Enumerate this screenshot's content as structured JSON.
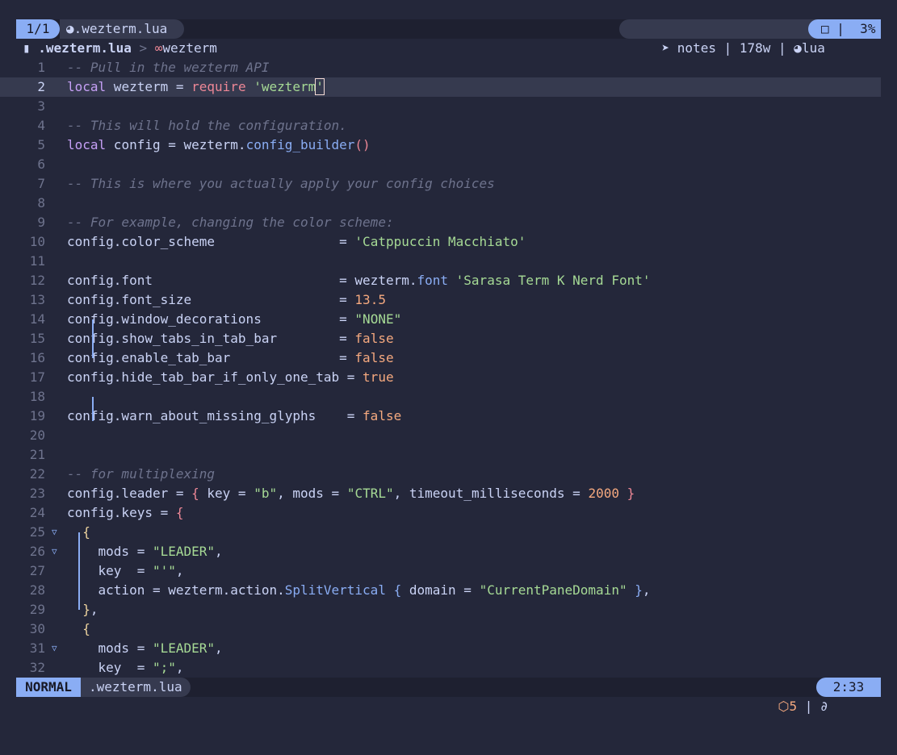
{
  "tabline": {
    "tab_count": "1/1",
    "file_icon": "lua-icon",
    "file_name": ".wezterm.lua",
    "right_icon": "notes-icon",
    "right_text": "notes | 178w | ",
    "lang_icon": "lua-icon",
    "lang": "lua",
    "window_icon": "square-icon",
    "percent": " 3%"
  },
  "winbar": {
    "file": ".wezterm.lua",
    "sep": " > ",
    "symbol_icon": "module-icon",
    "symbol": "wezterm"
  },
  "lines": [
    {
      "n": "1",
      "t": [
        {
          "c": "c",
          "v": "-- Pull in the wezterm API"
        }
      ]
    },
    {
      "n": "2",
      "cur": true,
      "t": [
        {
          "c": "k",
          "v": "local"
        },
        {
          "v": " wezterm = "
        },
        {
          "c": "f",
          "v": "require"
        },
        {
          "v": " "
        },
        {
          "c": "s",
          "v": "'wezterm"
        },
        {
          "c": "s cursor",
          "v": "'"
        }
      ]
    },
    {
      "n": "3",
      "t": []
    },
    {
      "n": "4",
      "t": [
        {
          "c": "c",
          "v": "-- This will hold the configuration."
        }
      ]
    },
    {
      "n": "5",
      "t": [
        {
          "c": "k",
          "v": "local"
        },
        {
          "v": " config = wezterm."
        },
        {
          "c": "m",
          "v": "config_builder"
        },
        {
          "c": "b1",
          "v": "()"
        }
      ]
    },
    {
      "n": "6",
      "t": []
    },
    {
      "n": "7",
      "t": [
        {
          "c": "c",
          "v": "-- This is where you actually apply your config choices"
        }
      ]
    },
    {
      "n": "8",
      "t": []
    },
    {
      "n": "9",
      "t": [
        {
          "c": "c",
          "v": "-- For example, changing the color scheme:"
        }
      ]
    },
    {
      "n": "10",
      "t": [
        {
          "v": "config.color_scheme                = "
        },
        {
          "c": "s",
          "v": "'Catppuccin Macchiato'"
        }
      ]
    },
    {
      "n": "11",
      "t": []
    },
    {
      "n": "12",
      "t": [
        {
          "v": "config.font                        = wezterm."
        },
        {
          "c": "m",
          "v": "font"
        },
        {
          "v": " "
        },
        {
          "c": "s",
          "v": "'Sarasa Term K Nerd Font'"
        }
      ]
    },
    {
      "n": "13",
      "t": [
        {
          "v": "config.font_size                   = "
        },
        {
          "c": "n",
          "v": "13.5"
        }
      ]
    },
    {
      "n": "14",
      "t": [
        {
          "v": "config.window_decorations          = "
        },
        {
          "c": "s",
          "v": "\"NONE\""
        }
      ]
    },
    {
      "n": "15",
      "t": [
        {
          "v": "config.show_tabs_in_tab_bar        = "
        },
        {
          "c": "n",
          "v": "false"
        }
      ]
    },
    {
      "n": "16",
      "t": [
        {
          "v": "config.enable_tab_bar              = "
        },
        {
          "c": "n",
          "v": "false"
        }
      ]
    },
    {
      "n": "17",
      "t": [
        {
          "v": "config.hide_tab_bar_if_only_one_tab = "
        },
        {
          "c": "n",
          "v": "true"
        }
      ]
    },
    {
      "n": "18",
      "t": []
    },
    {
      "n": "19",
      "t": [
        {
          "v": "config.warn_about_missing_glyphs    = "
        },
        {
          "c": "n",
          "v": "false"
        }
      ]
    },
    {
      "n": "20",
      "t": []
    },
    {
      "n": "21",
      "t": []
    },
    {
      "n": "22",
      "t": [
        {
          "c": "c",
          "v": "-- for multiplexing"
        }
      ]
    },
    {
      "n": "23",
      "t": [
        {
          "v": "config.leader = "
        },
        {
          "c": "b1",
          "v": "{"
        },
        {
          "v": " key = "
        },
        {
          "c": "s",
          "v": "\"b\""
        },
        {
          "v": ", mods = "
        },
        {
          "c": "s",
          "v": "\"CTRL\""
        },
        {
          "v": ", timeout_milliseconds = "
        },
        {
          "c": "n",
          "v": "2000"
        },
        {
          "v": " "
        },
        {
          "c": "b1",
          "v": "}"
        }
      ]
    },
    {
      "n": "24",
      "t": [
        {
          "v": "config.keys = "
        },
        {
          "c": "b1",
          "v": "{"
        }
      ]
    },
    {
      "n": "25",
      "fold": true,
      "t": [
        {
          "v": "  "
        },
        {
          "c": "b2",
          "v": "{"
        }
      ]
    },
    {
      "n": "26",
      "fold": true,
      "t": [
        {
          "v": "    mods = "
        },
        {
          "c": "s",
          "v": "\"LEADER\""
        },
        {
          "v": ","
        }
      ]
    },
    {
      "n": "27",
      "t": [
        {
          "v": "    key  = "
        },
        {
          "c": "s",
          "v": "\"'\""
        },
        {
          "v": ","
        }
      ]
    },
    {
      "n": "28",
      "t": [
        {
          "v": "    action = wezterm.action."
        },
        {
          "c": "m",
          "v": "SplitVertical"
        },
        {
          "v": " "
        },
        {
          "c": "m",
          "v": "{"
        },
        {
          "v": " domain = "
        },
        {
          "c": "s",
          "v": "\"CurrentPaneDomain\""
        },
        {
          "v": " "
        },
        {
          "c": "m",
          "v": "}"
        },
        {
          "v": ","
        }
      ]
    },
    {
      "n": "29",
      "t": [
        {
          "v": "  "
        },
        {
          "c": "b2",
          "v": "}"
        },
        {
          "v": ","
        }
      ]
    },
    {
      "n": "30",
      "t": [
        {
          "v": "  "
        },
        {
          "c": "b2",
          "v": "{"
        }
      ]
    },
    {
      "n": "31",
      "fold": true,
      "t": [
        {
          "v": "    mods = "
        },
        {
          "c": "s",
          "v": "\"LEADER\""
        },
        {
          "v": ","
        }
      ]
    },
    {
      "n": "32",
      "t": [
        {
          "v": "    key  = "
        },
        {
          "c": "s",
          "v": "\";\""
        },
        {
          "v": ","
        }
      ]
    }
  ],
  "status": {
    "mode": "NORMAL",
    "file": ".wezterm.lua",
    "package_icon": "package-icon",
    "count": "5",
    "sep": " | ",
    "lsp_icon": "lsp-icon",
    "time": "2:33"
  }
}
